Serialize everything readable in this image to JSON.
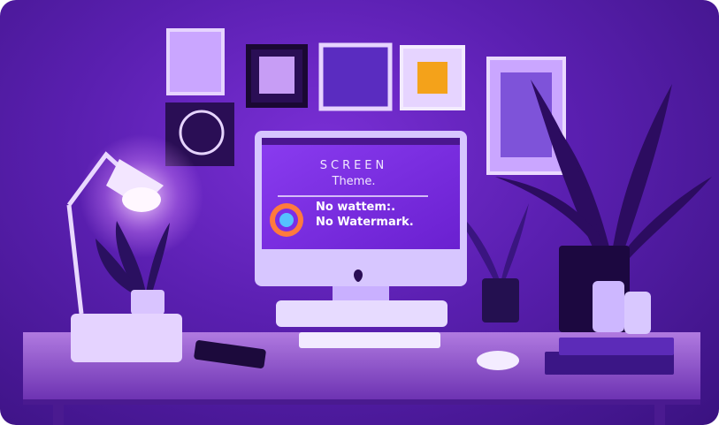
{
  "scene": {
    "monitor": {
      "brand_text": "SCREEN",
      "subtitle": "Theme.",
      "watermark_line1": "No wattem:.",
      "watermark_line2": "No Watermark.",
      "menu_items": [
        "",
        "",
        "",
        "",
        "",
        "",
        ""
      ]
    },
    "colors": {
      "wall": "#5a1fb0",
      "screen": "#7b2ee6",
      "lamp_glow": "#ffe9ff",
      "desk": "#9a5fd0"
    }
  }
}
